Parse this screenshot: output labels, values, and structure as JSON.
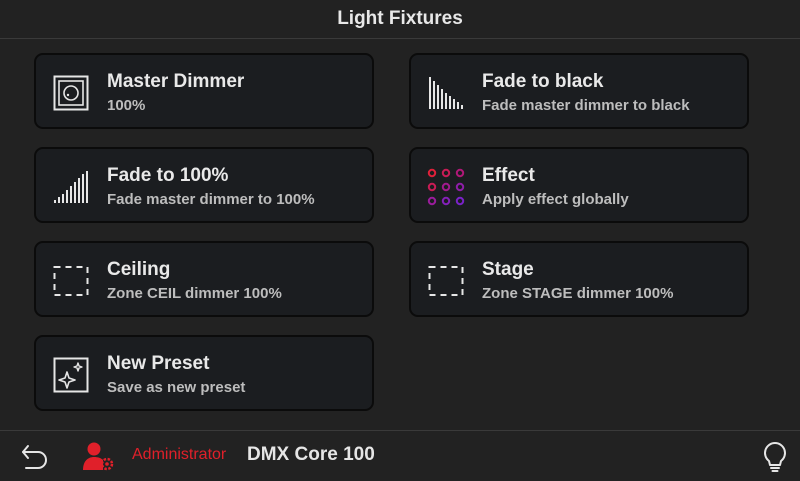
{
  "header": {
    "title": "Light Fixtures"
  },
  "cards": [
    {
      "label": "Master Dimmer",
      "sub": "100%",
      "icon": "dial-icon"
    },
    {
      "label": "Fade to black",
      "sub": "Fade master dimmer to black",
      "icon": "fade-down-icon"
    },
    {
      "label": "Fade to 100%",
      "sub": "Fade master dimmer to 100%",
      "icon": "fade-up-icon"
    },
    {
      "label": "Effect",
      "sub": "Apply effect globally",
      "icon": "effect-dots-icon"
    },
    {
      "label": "Ceiling",
      "sub": "Zone CEIL dimmer 100%",
      "icon": "zone-icon"
    },
    {
      "label": "Stage",
      "sub": "Zone STAGE dimmer 100%",
      "icon": "zone-icon"
    },
    {
      "label": "New Preset",
      "sub": "Save as new preset",
      "icon": "new-preset-icon"
    }
  ],
  "footer": {
    "user_label": "Administrator",
    "device_name": "DMX Core 100",
    "icons": [
      "back-icon",
      "admin-user-icon",
      "lightbulb-icon"
    ]
  },
  "colors": {
    "background": "#222222",
    "card_bg": "#1b1d20",
    "accent_red": "#e0202a",
    "effect_gradient": [
      "#e0203a",
      "#b01878",
      "#7a22c8"
    ]
  }
}
